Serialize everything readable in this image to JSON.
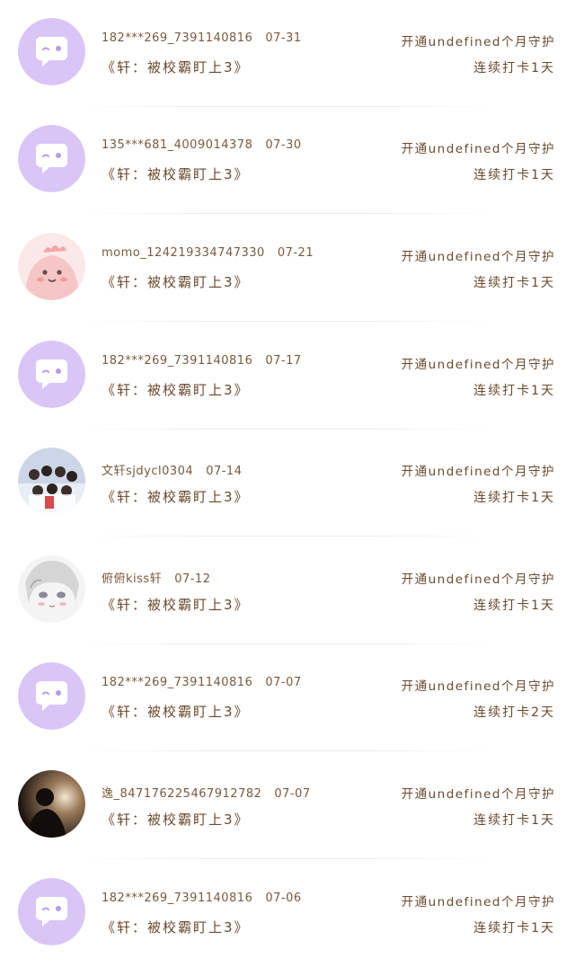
{
  "items": [
    {
      "user": "182***269_7391140816",
      "date": "07-31",
      "book": "《轩：被校霸盯上3》",
      "guard": "开通undefined个月守护",
      "streak": "连续打卡1天",
      "avatar": "default-chat-icon"
    },
    {
      "user": "135***681_4009014378",
      "date": "07-30",
      "book": "《轩：被校霸盯上3》",
      "guard": "开通undefined个月守护",
      "streak": "连续打卡1天",
      "avatar": "default-chat-icon"
    },
    {
      "user": "momo_124219334747330",
      "date": "07-21",
      "book": "《轩：被校霸盯上3》",
      "guard": "开通undefined个月守护",
      "streak": "连续打卡1天",
      "avatar": "pink-creature-avatar"
    },
    {
      "user": "182***269_7391140816",
      "date": "07-17",
      "book": "《轩：被校霸盯上3》",
      "guard": "开通undefined个月守护",
      "streak": "连续打卡1天",
      "avatar": "default-chat-icon"
    },
    {
      "user": "文轩sjdycl0304",
      "date": "07-14",
      "book": "《轩：被校霸盯上3》",
      "guard": "开通undefined个月守护",
      "streak": "连续打卡1天",
      "avatar": "group-photo-avatar"
    },
    {
      "user": "俯俯kiss轩",
      "date": "07-12",
      "book": "《轩：被校霸盯上3》",
      "guard": "开通undefined个月守护",
      "streak": "连续打卡1天",
      "avatar": "anime-girl-avatar"
    },
    {
      "user": "182***269_7391140816",
      "date": "07-07",
      "book": "《轩：被校霸盯上3》",
      "guard": "开通undefined个月守护",
      "streak": "连续打卡2天",
      "avatar": "default-chat-icon"
    },
    {
      "user": "逸_847176225467912782",
      "date": "07-07",
      "book": "《轩：被校霸盯上3》",
      "guard": "开通undefined个月守护",
      "streak": "连续打卡1天",
      "avatar": "silhouette-sunset-avatar"
    },
    {
      "user": "182***269_7391140816",
      "date": "07-06",
      "book": "《轩：被校霸盯上3》",
      "guard": "开通undefined个月守护",
      "streak": "连续打卡1天",
      "avatar": "default-chat-icon"
    }
  ],
  "colors": {
    "default_avatar_bg": "#d9c6f7",
    "text_brown": "#6b4a2e"
  }
}
